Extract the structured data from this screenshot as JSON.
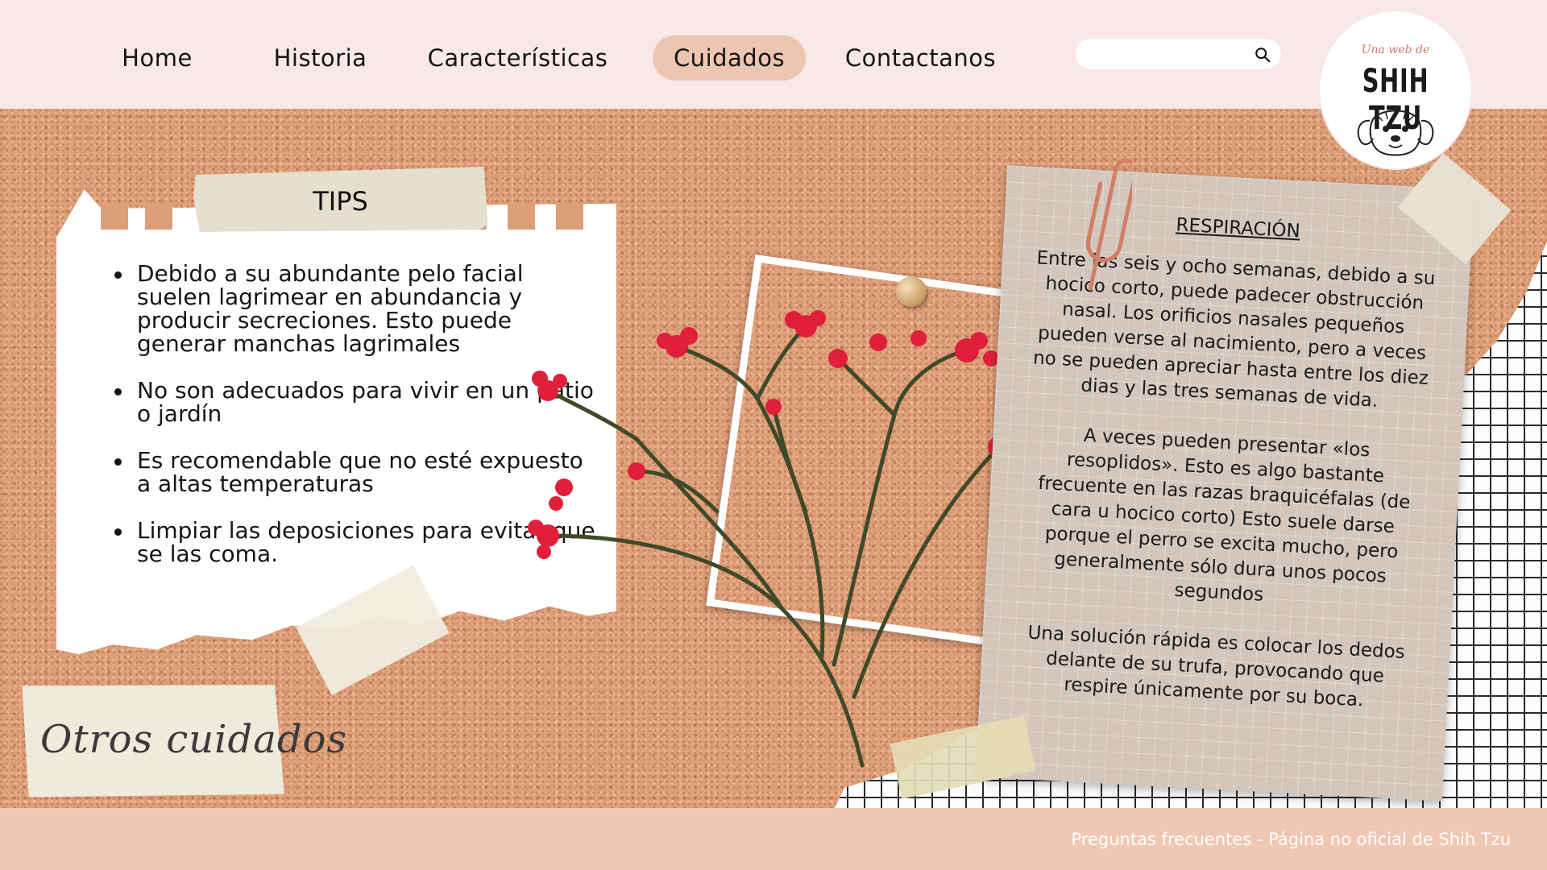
{
  "nav": {
    "items": [
      {
        "label": "Home"
      },
      {
        "label": "Historia"
      },
      {
        "label": "Características"
      },
      {
        "label": "Cuidados"
      },
      {
        "label": "Contactanos"
      }
    ],
    "active": "Cuidados"
  },
  "search": {
    "placeholder": "",
    "value": "",
    "icon": "search-icon"
  },
  "logo": {
    "script": "Una web de",
    "title": "SHIH TZU",
    "icon": "dog-face-icon"
  },
  "tips": {
    "title": "TIPS",
    "items": [
      "Debido a su abundante pelo facial suelen lagrimear en abundancia y producir secreciones. Esto puede generar manchas lagrimales",
      "No son adecuados para vivir en un patio o jardín",
      " Es recomendable que no esté expuesto a altas temperaturas",
      "Limpiar las deposiciones para evitar que se las coma."
    ]
  },
  "otros": {
    "label": "Otros cuidados"
  },
  "respiracion": {
    "title": "RESPIRACIÓN",
    "paragraphs": [
      "Entre las seis y ocho semanas, debido a su hocico corto, puede padecer obstrucción nasal. Los orificios nasales pequeños pueden verse al nacimiento, pero a veces no se pueden apreciar hasta entre los diez dias y las tres semanas de vida.",
      "A veces pueden presentar «los resoplidos». Esto es algo bastante frecuente en las razas braquicéfalas (de cara u hocico corto) Esto suele darse porque el perro se excita mucho, pero generalmente sólo dura unos pocos segundos",
      "Una solución rápida es colocar los dedos delante de su trufa, provocando que respire únicamente por su boca."
    ]
  },
  "footer": {
    "text": "Preguntas frecuentes - Página no oficial de Shih Tzu"
  },
  "colors": {
    "header_bg": "#f8e8e7",
    "active_pill": "#ecc6b1",
    "cork": "#de9e78",
    "note": "#d3c7bd",
    "footer_bg": "#f0c7b3"
  }
}
